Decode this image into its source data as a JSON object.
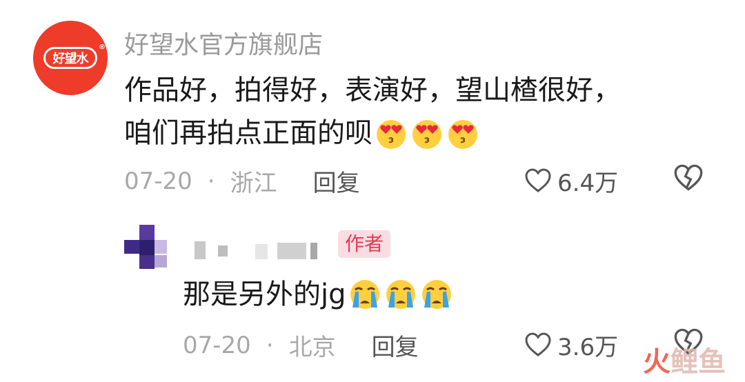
{
  "comments": [
    {
      "username": "好望水官方旗舰店",
      "avatar_logo_text": "好望水",
      "text_line1": "作品好，拍得好，表演好，望山楂很好，",
      "text_line2": "咱们再拍点正面的呗",
      "emojis": [
        "heart-eyes-emoji",
        "heart-eyes-emoji",
        "heart-eyes-emoji"
      ],
      "date": "07-20",
      "separator": "·",
      "location": "浙江",
      "reply_label": "回复",
      "likes": "6.4万"
    },
    {
      "username": "",
      "author_badge": "作者",
      "text": "那是另外的jg",
      "emojis": [
        "crying-emoji",
        "crying-emoji",
        "crying-emoji"
      ],
      "date": "07-20",
      "separator": "·",
      "location": "北京",
      "reply_label": "回复",
      "likes": "3.6万"
    }
  ],
  "watermark": {
    "part1": "火",
    "part2": "鲤鱼"
  },
  "colors": {
    "brand_red": "#ee3b2a",
    "badge_bg": "#f9dde3",
    "badge_text": "#e33b55",
    "muted_text": "#a8a8a8"
  }
}
